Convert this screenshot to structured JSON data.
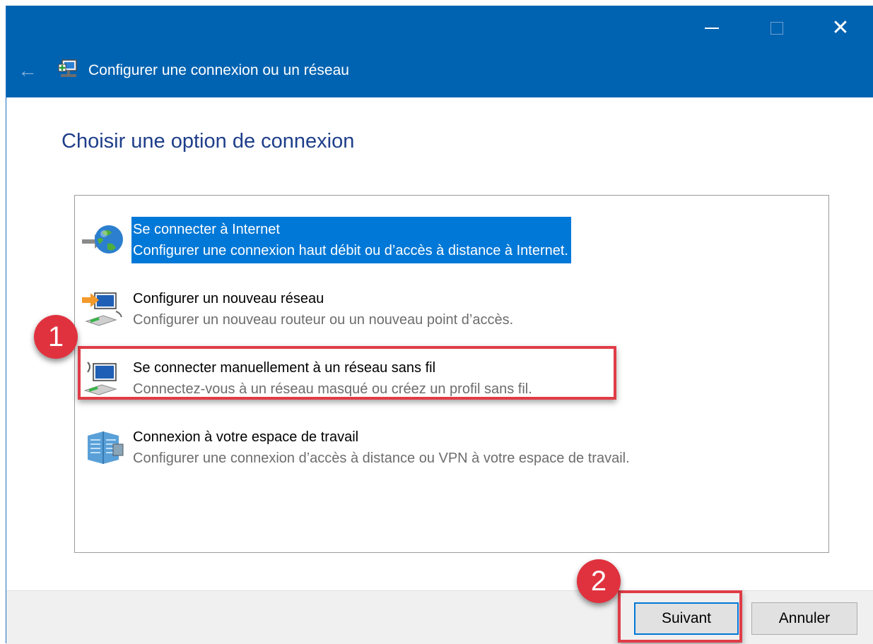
{
  "window": {
    "title": "Configurer une connexion ou un réseau",
    "controls": {
      "minimize": "—",
      "maximize": "□",
      "close": "✕"
    },
    "back_glyph": "←"
  },
  "page": {
    "heading": "Choisir une option de connexion"
  },
  "options": [
    {
      "title": "Se connecter à Internet",
      "description": "Configurer une connexion haut débit ou d’accès à distance à Internet.",
      "icon": "globe-icon",
      "selected": true
    },
    {
      "title": "Configurer un nouveau réseau",
      "description": "Configurer un nouveau routeur ou un nouveau point d’accès.",
      "icon": "new-network-icon",
      "selected": false
    },
    {
      "title": "Se connecter manuellement à un réseau sans fil",
      "description": "Connectez-vous à un réseau masqué ou créez un profil sans fil.",
      "icon": "wireless-network-icon",
      "selected": false
    },
    {
      "title": "Connexion à votre espace de travail",
      "description": "Configurer une connexion d’accès à distance ou VPN à votre espace de travail.",
      "icon": "workplace-building-icon",
      "selected": false
    }
  ],
  "annotations": {
    "step1": "1",
    "step2": "2",
    "highlight_color": "#e03c47"
  },
  "buttons": {
    "next": "Suivant",
    "cancel": "Annuler"
  },
  "colors": {
    "titlebar": "#0063b1",
    "heading": "#1e3e8a",
    "selection": "#0078d7"
  }
}
